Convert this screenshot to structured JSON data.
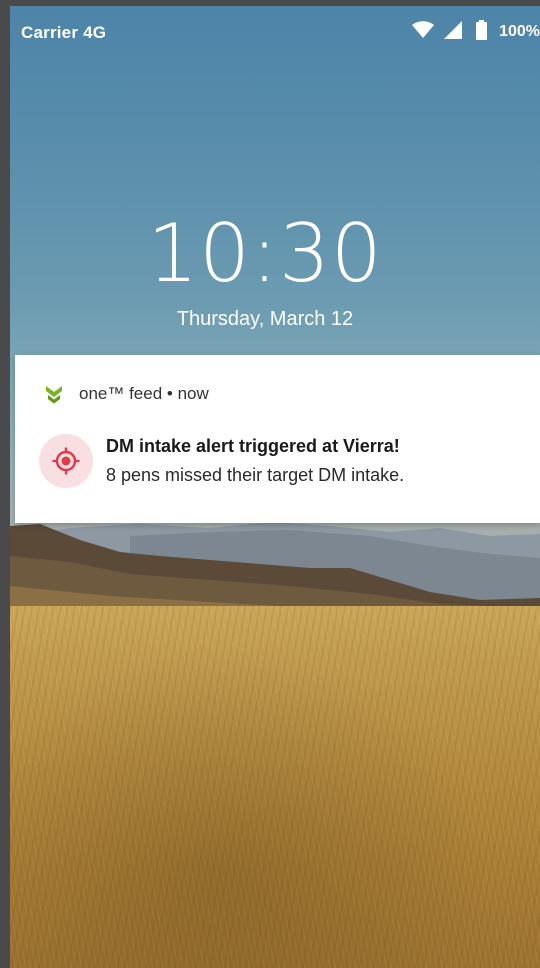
{
  "status_bar": {
    "carrier": "Carrier 4G",
    "battery_percent": "100%",
    "icons": [
      "wifi-icon",
      "cell-signal-icon",
      "battery-icon"
    ]
  },
  "lock_screen": {
    "time": "10:30",
    "date": "Thursday, March 12"
  },
  "notification": {
    "app_icon": "one-feed-app-icon",
    "header": "one™ feed • now",
    "icon": "target-icon",
    "title": "DM intake alert triggered at Vierra!",
    "text": "8 pens missed their target DM intake.",
    "accent_color": "#e03a4a",
    "icon_background": "#f9dfe2",
    "app_icon_color": "#7ab51d"
  }
}
